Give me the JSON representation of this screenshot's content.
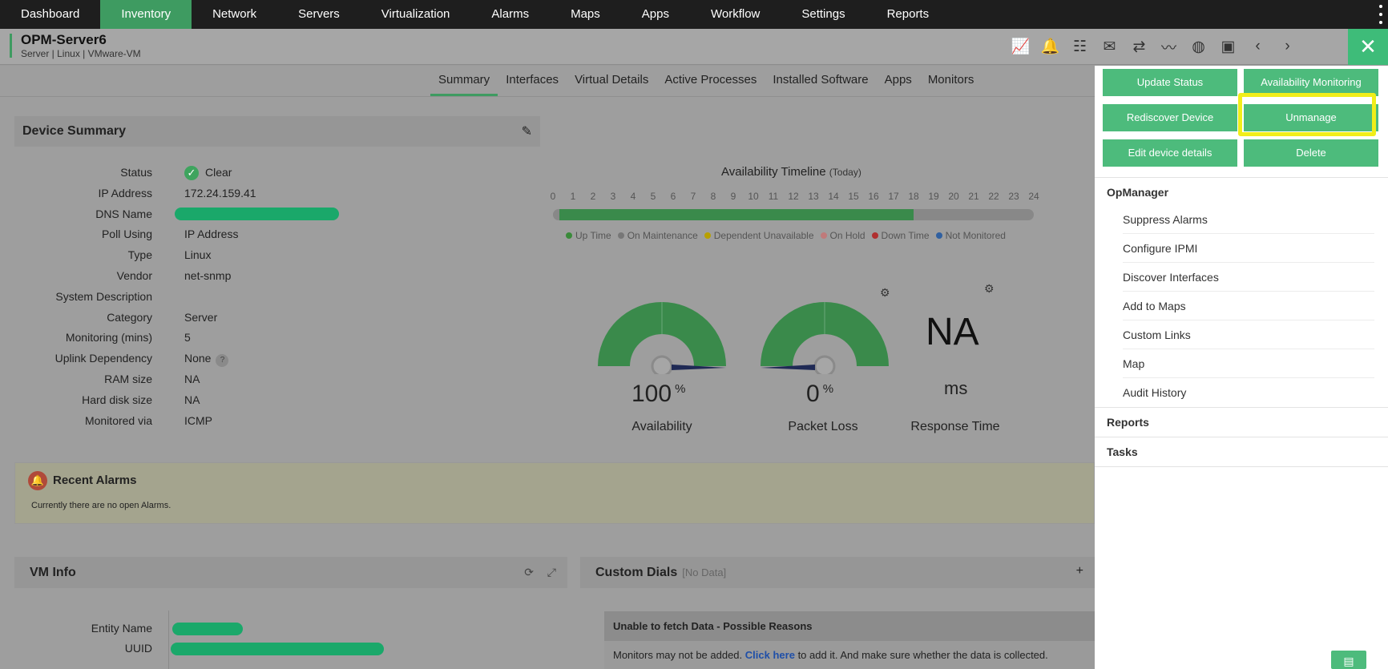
{
  "nav": {
    "items": [
      "Dashboard",
      "Inventory",
      "Network",
      "Servers",
      "Virtualization",
      "Alarms",
      "Maps",
      "Apps",
      "Workflow",
      "Settings",
      "Reports"
    ],
    "active": "Inventory"
  },
  "device": {
    "name": "OPM-Server6",
    "subtitle": "Server | Linux | VMware-VM"
  },
  "header_icons": [
    "chart-icon",
    "alarm-icon",
    "network-tree-icon",
    "mail-icon",
    "sync-icon",
    "graph-icon",
    "globe-icon",
    "terminal-icon",
    "prev-icon",
    "next-icon"
  ],
  "tabs": [
    "Summary",
    "Interfaces",
    "Virtual Details",
    "Active Processes",
    "Installed Software",
    "Apps",
    "Monitors"
  ],
  "device_summary": {
    "title": "Device Summary",
    "rows": [
      {
        "label": "Status",
        "value": "Clear"
      },
      {
        "label": "IP Address",
        "value": "172.24.159.41"
      },
      {
        "label": "DNS Name",
        "value": ""
      },
      {
        "label": "Poll Using",
        "value": "IP Address"
      },
      {
        "label": "Type",
        "value": "Linux"
      },
      {
        "label": "Vendor",
        "value": "net-snmp"
      },
      {
        "label": "System Description",
        "value": ""
      },
      {
        "label": "Category",
        "value": "Server"
      },
      {
        "label": "Monitoring (mins)",
        "value": "5"
      },
      {
        "label": "Uplink Dependency",
        "value": "None"
      },
      {
        "label": "RAM size",
        "value": "NA"
      },
      {
        "label": "Hard disk size",
        "value": "NA"
      },
      {
        "label": "Monitored via",
        "value": "ICMP"
      }
    ]
  },
  "timeline": {
    "title": "Availability Timeline",
    "period": "(Today)",
    "hours": [
      "0",
      "1",
      "2",
      "3",
      "4",
      "5",
      "6",
      "7",
      "8",
      "9",
      "10",
      "11",
      "12",
      "13",
      "14",
      "15",
      "16",
      "17",
      "18",
      "19",
      "20",
      "21",
      "22",
      "23",
      "24"
    ],
    "uptime_until_hour": 18,
    "legend": [
      {
        "label": "Up Time",
        "color": "#3a8a3a"
      },
      {
        "label": "On Maintenance",
        "color": "#777777"
      },
      {
        "label": "Dependent Unavailable",
        "color": "#b8a000"
      },
      {
        "label": "On Hold",
        "color": "#c07a7a"
      },
      {
        "label": "Down Time",
        "color": "#b03030"
      },
      {
        "label": "Not Monitored",
        "color": "#3060a0"
      }
    ]
  },
  "dials": {
    "availability": {
      "value": "100",
      "unit": "%",
      "label": "Availability",
      "fraction": 1.0
    },
    "packet_loss": {
      "value": "0",
      "unit": "%",
      "label": "Packet Loss",
      "fraction": 0.0
    },
    "response_time": {
      "value": "NA",
      "unit": "ms",
      "label": "Response Time"
    }
  },
  "alarms": {
    "title": "Recent Alarms",
    "message": "Currently there are no open Alarms."
  },
  "vm_info": {
    "title": "VM Info",
    "rows": [
      {
        "label": "Entity Name",
        "value": ""
      },
      {
        "label": "UUID",
        "value": ""
      }
    ]
  },
  "custom_dials": {
    "title": "Custom Dials",
    "note": "[No Data]",
    "error_title": "Unable to fetch Data - Possible Reasons",
    "error_text_before": "Monitors may not be added.",
    "error_link": "Click here",
    "error_text_after": "to add it. And make sure whether the data is collected."
  },
  "actions_menu": {
    "buttons": [
      "Update Status",
      "Availability Monitoring",
      "Rediscover Device",
      "Unmanage",
      "Edit device details",
      "Delete"
    ],
    "highlighted": "Unmanage",
    "opmanager_title": "OpManager",
    "opmanager_items": [
      "Suppress Alarms",
      "Configure IPMI",
      "Discover Interfaces",
      "Add to Maps",
      "Custom Links",
      "Map",
      "Audit History"
    ],
    "reports_title": "Reports",
    "tasks_title": "Tasks"
  }
}
